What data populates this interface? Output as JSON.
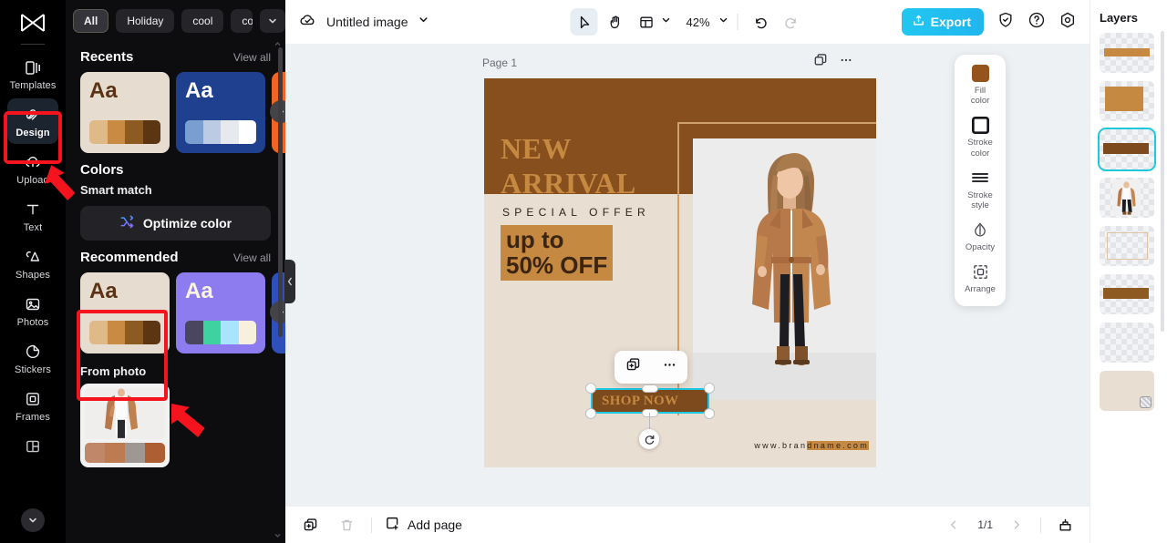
{
  "app": {
    "brand_icon": "capcut-logo-icon"
  },
  "rail": {
    "items": [
      {
        "label": "Templates",
        "icon": "templates-icon",
        "active": false
      },
      {
        "label": "Design",
        "icon": "design-icon",
        "active": true
      },
      {
        "label": "Upload",
        "icon": "upload-cloud-icon",
        "active": false
      },
      {
        "label": "Text",
        "icon": "text-icon",
        "active": false
      },
      {
        "label": "Shapes",
        "icon": "shapes-icon",
        "active": false
      },
      {
        "label": "Photos",
        "icon": "photos-icon",
        "active": false
      },
      {
        "label": "Stickers",
        "icon": "stickers-icon",
        "active": false
      },
      {
        "label": "Frames",
        "icon": "frames-icon",
        "active": false
      }
    ],
    "more_icon": "chevron-down-icon"
  },
  "panel": {
    "chips": [
      {
        "label": "All",
        "selected": true
      },
      {
        "label": "Holiday",
        "selected": false
      },
      {
        "label": "cool",
        "selected": false
      },
      {
        "label": "con",
        "selected": false,
        "clipped": true
      }
    ],
    "chips_more_icon": "chevron-down-icon",
    "recents": {
      "title": "Recents",
      "view_all": "View all",
      "cards": [
        {
          "aa": "Aa",
          "bg": "#e7dcd0",
          "aa_color": "#5b3213",
          "swatches": [
            "#e0b988",
            "#c98b44",
            "#8d5a21",
            "#5c3612"
          ]
        },
        {
          "aa": "Aa",
          "bg": "#1f3f8f",
          "aa_color": "#ffffff",
          "swatches": [
            "#7b9ed0",
            "#bacbe3",
            "#e6eaef",
            "#ffffff"
          ]
        }
      ],
      "next_icon": "chevron-right-icon"
    },
    "colors": {
      "title": "Colors",
      "smart_match_label": "Smart match",
      "optimize_label": "Optimize color",
      "optimize_icon": "shuffle-icon"
    },
    "recommended": {
      "title": "Recommended",
      "view_all": "View all",
      "cards": [
        {
          "aa": "Aa",
          "bg": "#e7dcd0",
          "aa_color": "#5b3213",
          "swatches": [
            "#e0b988",
            "#c98b44",
            "#8d5a21",
            "#5c3612"
          ],
          "highlighted": true
        },
        {
          "aa": "Aa",
          "bg": "#8d7cf0",
          "aa_color": "#faf4e0",
          "swatches": [
            "#4a4660",
            "#3ed2a0",
            "#a8e4fb",
            "#f6f0dc"
          ],
          "highlighted": false
        }
      ],
      "next_icon": "chevron-right-icon"
    },
    "from_photo": {
      "title": "From photo",
      "swatches": [
        "#c08868",
        "#bc7b50",
        "#9e9793",
        "#ad5f33"
      ]
    },
    "collapse_icon": "chevron-left-icon"
  },
  "topbar": {
    "cloud_icon": "cloud-saved-icon",
    "doc_title": "Untitled image",
    "title_caret_icon": "chevron-down-icon",
    "tools": [
      {
        "name": "select",
        "icon": "cursor-arrow-icon",
        "selected": true
      },
      {
        "name": "hand",
        "icon": "hand-icon",
        "selected": false
      },
      {
        "name": "layout",
        "icon": "layout-icon",
        "selected": false
      }
    ],
    "layout_caret_icon": "chevron-down-icon",
    "zoom_value": "42%",
    "zoom_caret_icon": "chevron-down-icon",
    "undo_icon": "undo-icon",
    "redo_icon": "redo-icon",
    "export_label": "Export",
    "export_icon": "export-upload-icon",
    "export_color": "#21c0ef",
    "right_icons": [
      {
        "name": "shield-check-icon"
      },
      {
        "name": "help-circle-icon"
      },
      {
        "name": "settings-gear-icon"
      }
    ]
  },
  "canvas": {
    "page_label": "Page 1",
    "duplicate_icon": "duplicate-page-icon",
    "more_icon": "more-horizontal-icon",
    "design": {
      "headline_line1": "NEW",
      "headline_line2": "ARRIVAL",
      "subhead": "SPECIAL OFFER",
      "badge_line1": "up to",
      "badge_line2": "50% OFF",
      "url_plain": "www.bran",
      "url_highlight": "dname.com",
      "selected_text": "SHOP NOW",
      "band_color": "#864f1d",
      "bg_color": "#e9ded2",
      "accent_color": "#c68941",
      "button_color": "#7c4a1c"
    },
    "selection": {
      "context_duplicate_icon": "duplicate-icon",
      "context_more_icon": "more-horizontal-icon",
      "rotate_icon": "rotate-icon",
      "handle_color": "#1ec8e0"
    }
  },
  "propbar": {
    "items": [
      {
        "label": "Fill\ncolor",
        "line1": "Fill",
        "line2": "color",
        "icon": "fill-color-icon",
        "swatch": "#95541b"
      },
      {
        "label": "Stroke color",
        "line1": "Stroke",
        "line2": "color",
        "icon": "stroke-color-icon",
        "swatch": ""
      },
      {
        "label": "Stroke style",
        "line1": "Stroke",
        "line2": "style",
        "icon": "stroke-style-icon",
        "swatch": ""
      },
      {
        "label": "Opacity",
        "line1": "Opacity",
        "line2": "",
        "icon": "opacity-drop-icon",
        "swatch": ""
      },
      {
        "label": "Arrange",
        "line1": "Arrange",
        "line2": "",
        "icon": "arrange-icon",
        "swatch": ""
      }
    ]
  },
  "layers": {
    "title": "Layers",
    "items": [
      {
        "kind": "bar-thin",
        "color": "#c68941",
        "selected": false
      },
      {
        "kind": "rect-large",
        "color": "#c68941",
        "selected": false
      },
      {
        "kind": "bar-thick",
        "color": "#7c4a1c",
        "selected": true
      },
      {
        "kind": "photo",
        "color": "",
        "selected": false
      },
      {
        "kind": "frame",
        "color": "#dcc4a4",
        "selected": false
      },
      {
        "kind": "bar-thick",
        "color": "#8d5a21",
        "selected": false
      },
      {
        "kind": "empty",
        "color": "",
        "selected": false
      },
      {
        "kind": "background",
        "color": "#e9ded2",
        "selected": false
      }
    ]
  },
  "bottombar": {
    "duplicate_icon": "duplicate-page-icon",
    "delete_icon": "trash-icon",
    "add_page_label": "Add page",
    "add_page_icon": "add-page-icon",
    "prev_icon": "chevron-left-icon",
    "next_icon": "chevron-right-icon",
    "page_indicator": "1/1",
    "grid_view_icon": "pages-view-icon"
  }
}
